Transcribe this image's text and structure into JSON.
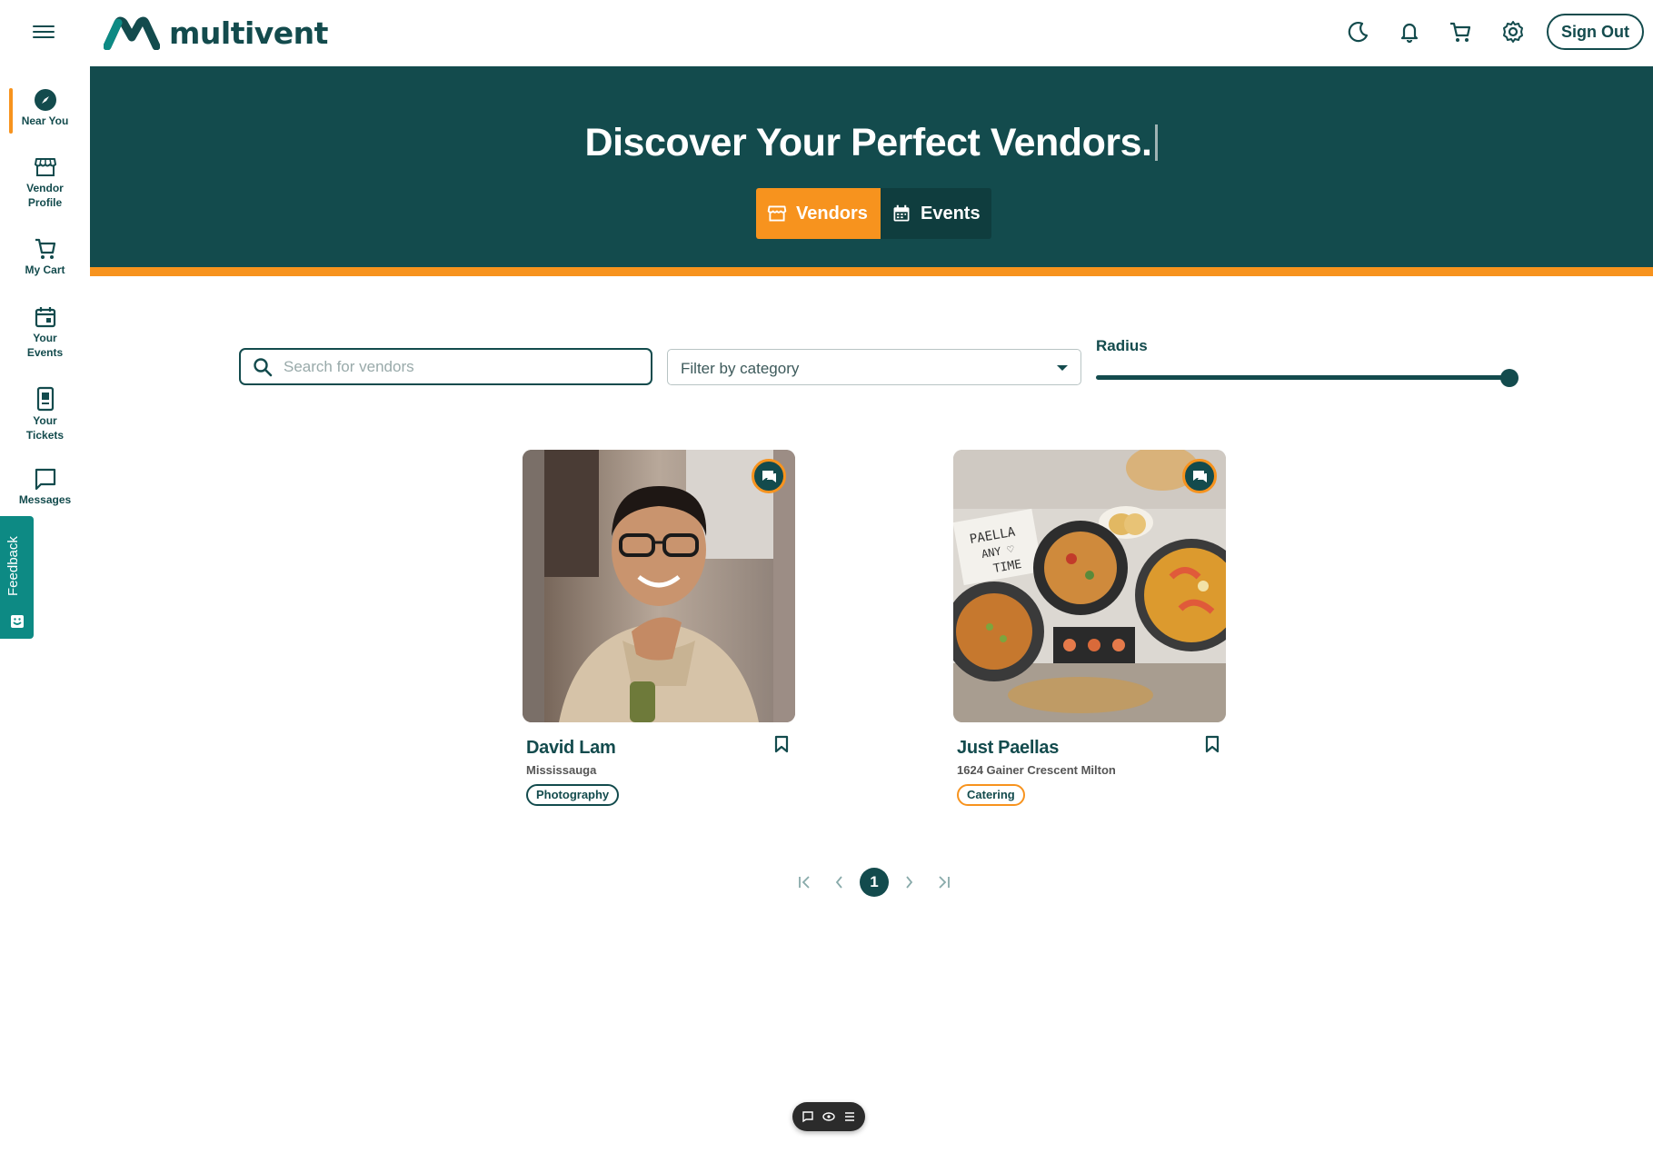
{
  "header": {
    "logo_text": "multivent",
    "sign_out_label": "Sign Out",
    "icons": [
      "moon-icon",
      "bell-icon",
      "cart-icon",
      "gear-icon"
    ]
  },
  "sidebar": {
    "items": [
      {
        "label": "Near You",
        "icon": "compass-icon"
      },
      {
        "label": "Vendor Profile",
        "icon": "store-icon"
      },
      {
        "label": "My Cart",
        "icon": "cart-icon"
      },
      {
        "label": "Your Events",
        "icon": "calendar-icon"
      },
      {
        "label": "Your Tickets",
        "icon": "ticket-icon"
      },
      {
        "label": "Messages",
        "icon": "message-icon"
      }
    ],
    "active": "Near You",
    "feedback_label": "Feedback"
  },
  "hero": {
    "title": "Discover Your Perfect Vendors.",
    "tabs": [
      {
        "label": "Vendors",
        "active": true
      },
      {
        "label": "Events",
        "active": false
      }
    ]
  },
  "filters": {
    "search_placeholder": "Search for vendors",
    "category_placeholder": "Filter by category",
    "radius_label": "Radius",
    "radius_value_fraction": 1.0
  },
  "vendors": [
    {
      "name": "David Lam",
      "location": "Mississauga",
      "category": "Photography",
      "tag_color": "#134b4d"
    },
    {
      "name": "Just Paellas",
      "location": "1624 Gainer Crescent Milton",
      "category": "Catering",
      "tag_color": "#f7931e"
    }
  ],
  "pagination": {
    "current_page": "1",
    "first": "|<",
    "prev": "<",
    "next": ">",
    "last": ">|"
  },
  "colors": {
    "brand_dark": "#134b4d",
    "accent": "#f7931e",
    "teal": "#0d8a84"
  }
}
